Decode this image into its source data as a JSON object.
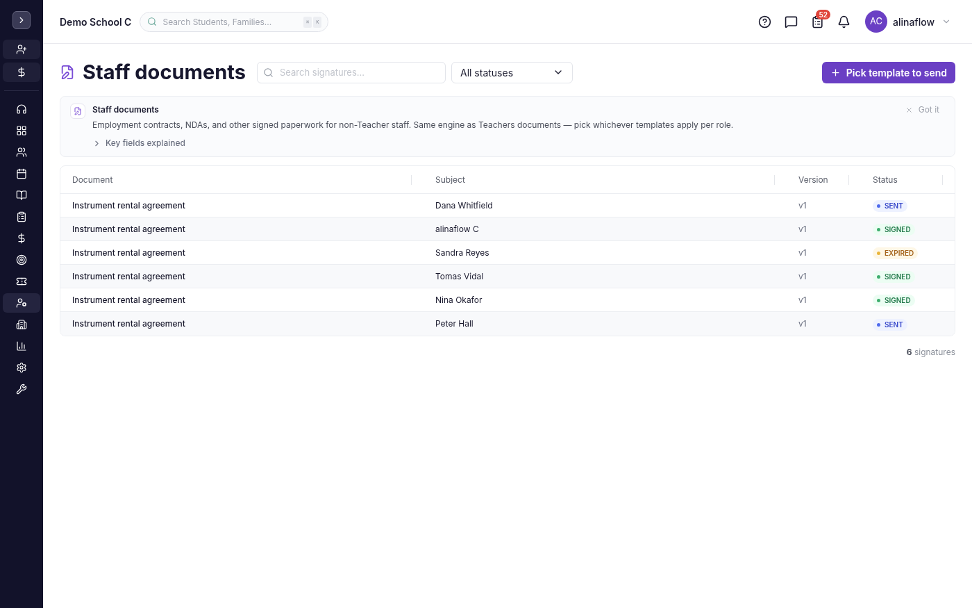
{
  "sidebar": {
    "quick_actions": [
      {
        "kind": "user-plus"
      },
      {
        "kind": "dollar"
      }
    ],
    "items": [
      {
        "kind": "headset",
        "selected": false
      },
      {
        "kind": "grid",
        "selected": false
      },
      {
        "kind": "users",
        "selected": false
      },
      {
        "kind": "calendar",
        "selected": false
      },
      {
        "kind": "book",
        "selected": false
      },
      {
        "kind": "clipboard",
        "selected": false
      },
      {
        "kind": "dollar",
        "selected": false
      },
      {
        "kind": "target",
        "selected": false
      },
      {
        "kind": "ticket",
        "selected": false
      },
      {
        "kind": "user-cog",
        "selected": true
      },
      {
        "kind": "building",
        "selected": false
      },
      {
        "kind": "chart",
        "selected": false
      },
      {
        "kind": "settings",
        "selected": false
      },
      {
        "kind": "wrench",
        "selected": false
      }
    ]
  },
  "topbar": {
    "school": "Demo School C",
    "search": {
      "placeholder": "Search Students, Families...",
      "keys": [
        "⌘",
        "K"
      ]
    },
    "tasks_badge": "52",
    "user": {
      "initials": "AC",
      "name": "alinaflow"
    }
  },
  "page": {
    "title": "Staff documents",
    "search": {
      "placeholder": "Search signatures..."
    },
    "status_filter": "All statuses",
    "primary_button": "Pick template to send"
  },
  "info": {
    "title": "Staff documents",
    "text": "Employment contracts, NDAs, and other signed paperwork for non-Teacher staff. Same engine as Teachers documents — pick whichever templates apply per role.",
    "dismiss": "Got it",
    "expander": {
      "label": "Key fields explained",
      "expanded": false
    }
  },
  "table": {
    "columns": [
      "Document",
      "Subject",
      "Version",
      "Status"
    ],
    "rows": [
      {
        "document": "Instrument rental agreement",
        "subject": "Dana Whitfield",
        "version": "v1",
        "status": {
          "label": "SENT",
          "kind": "sent"
        }
      },
      {
        "document": "Instrument rental agreement",
        "subject": "alinaflow C",
        "version": "v1",
        "status": {
          "label": "SIGNED",
          "kind": "signed"
        }
      },
      {
        "document": "Instrument rental agreement",
        "subject": "Sandra Reyes",
        "version": "v1",
        "status": {
          "label": "EXPIRED",
          "kind": "expired"
        }
      },
      {
        "document": "Instrument rental agreement",
        "subject": "Tomas Vidal",
        "version": "v1",
        "status": {
          "label": "SIGNED",
          "kind": "signed"
        }
      },
      {
        "document": "Instrument rental agreement",
        "subject": "Nina Okafor",
        "version": "v1",
        "status": {
          "label": "SIGNED",
          "kind": "signed"
        }
      },
      {
        "document": "Instrument rental agreement",
        "subject": "Peter Hall",
        "version": "v1",
        "status": {
          "label": "SENT",
          "kind": "sent"
        }
      }
    ]
  },
  "footer": "**6** signatures"
}
